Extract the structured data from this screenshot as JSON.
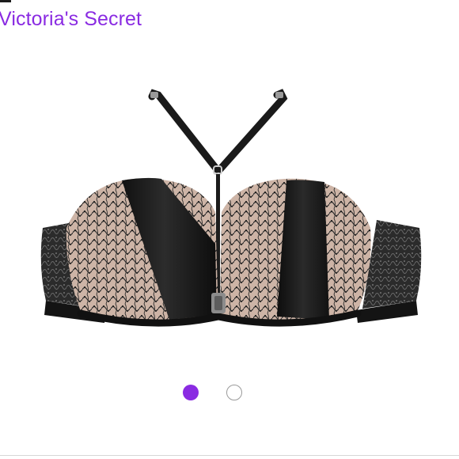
{
  "listing": {
    "brand": "Victoria's Secret",
    "product_image": {
      "alt": "black satin and lace racerback push-up bra"
    },
    "carousel": {
      "total_images": 2,
      "active_index": 1
    }
  },
  "colors": {
    "brand": "#8a2be2",
    "dot_active": "#8a2be2",
    "dot_inactive_border": "#9a9a9a"
  }
}
